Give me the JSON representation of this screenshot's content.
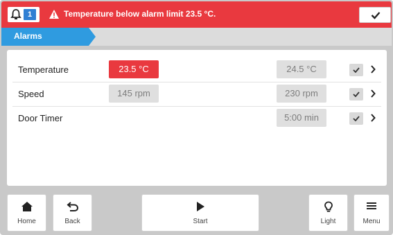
{
  "alarm_bar": {
    "count": "1",
    "message": "Temperature below alarm limit 23.5 °C.",
    "color": "#e9393f"
  },
  "breadcrumb": {
    "label": "Alarms",
    "color": "#2f9be0"
  },
  "alarms": [
    {
      "label": "Temperature",
      "low": "23.5 °C",
      "high": "24.5 °C",
      "low_in_alarm": true
    },
    {
      "label": "Speed",
      "low": "145 rpm",
      "high": "230 rpm",
      "low_in_alarm": false
    },
    {
      "label": "Door Timer",
      "low": "",
      "high": "5:00 min",
      "low_in_alarm": false
    }
  ],
  "nav": {
    "home": "Home",
    "back": "Back",
    "start": "Start",
    "light": "Light",
    "menu": "Menu"
  },
  "icons": {
    "bell": "bell-icon",
    "warning": "warning-icon",
    "check": "check-icon",
    "chevron": "chevron-right-icon",
    "home": "home-icon",
    "back": "back-arrow-icon",
    "start": "play-icon",
    "light": "bulb-icon",
    "menu": "hamburger-icon"
  }
}
